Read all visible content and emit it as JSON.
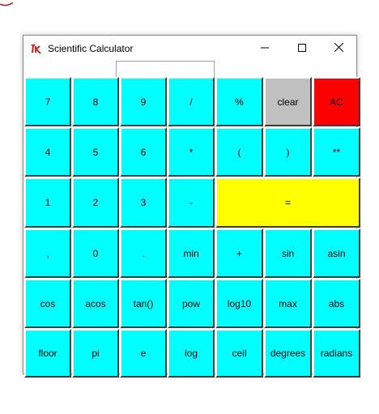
{
  "window": {
    "title": "Scientific Calculator",
    "icon": "tk-feather-icon"
  },
  "display": {
    "value": ""
  },
  "colors": {
    "key": "#00ffff",
    "clear": "#c0c0c0",
    "all_clear": "#ff0000",
    "equals": "#ffff00"
  },
  "keys": [
    "7",
    "8",
    "9",
    "/",
    "%",
    "clear",
    "AC",
    "4",
    "5",
    "6",
    "*",
    "(",
    ")",
    "**",
    "1",
    "2",
    "3",
    "-",
    "=",
    ",",
    "0",
    ".",
    "min",
    "+",
    "sin",
    "asin",
    "cos",
    "acos",
    "tan()",
    "pow",
    "log10",
    "max",
    "abs",
    "floor",
    "pi",
    "e",
    "log",
    "ceil",
    "degrees",
    "radians"
  ]
}
